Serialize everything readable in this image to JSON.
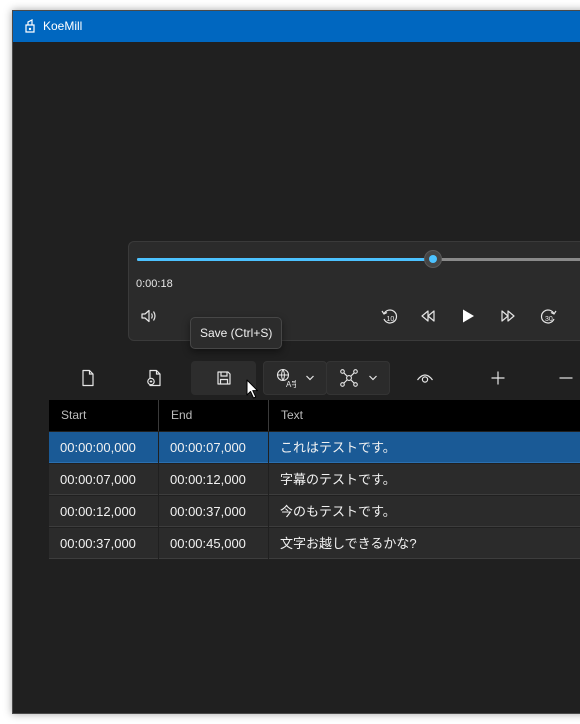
{
  "window": {
    "title": "KoeMill"
  },
  "player": {
    "current_time": "0:00:18",
    "progress": 0.63,
    "buttons": {
      "volume": "volume-icon",
      "back10": "rewind-10-icon",
      "prev": "previous-icon",
      "play": "play-icon",
      "next": "next-icon",
      "fwd30": "forward-30-icon"
    }
  },
  "tooltip": {
    "text": "Save (Ctrl+S)"
  },
  "toolbar": {
    "items": [
      "new-file-icon",
      "open-file-icon",
      "save-icon",
      "translate-icon",
      "network-icon",
      "eye-icon",
      "add-icon",
      "remove-icon"
    ]
  },
  "grid": {
    "columns": [
      "Start",
      "End",
      "Text"
    ],
    "rows": [
      {
        "start": "00:00:00,000",
        "end": "00:00:07,000",
        "text": "これはテストです。",
        "selected": true
      },
      {
        "start": "00:00:07,000",
        "end": "00:00:12,000",
        "text": "字幕のテストです。",
        "selected": false
      },
      {
        "start": "00:00:12,000",
        "end": "00:00:37,000",
        "text": "今のもテストです。",
        "selected": false
      },
      {
        "start": "00:00:37,000",
        "end": "00:00:45,000",
        "text": "文字お越しできるかな?",
        "selected": false
      }
    ]
  },
  "colors": {
    "accent": "#4cc2ff",
    "titlebar": "#0067c0",
    "selection": "#1a5a96",
    "background": "#202020"
  }
}
